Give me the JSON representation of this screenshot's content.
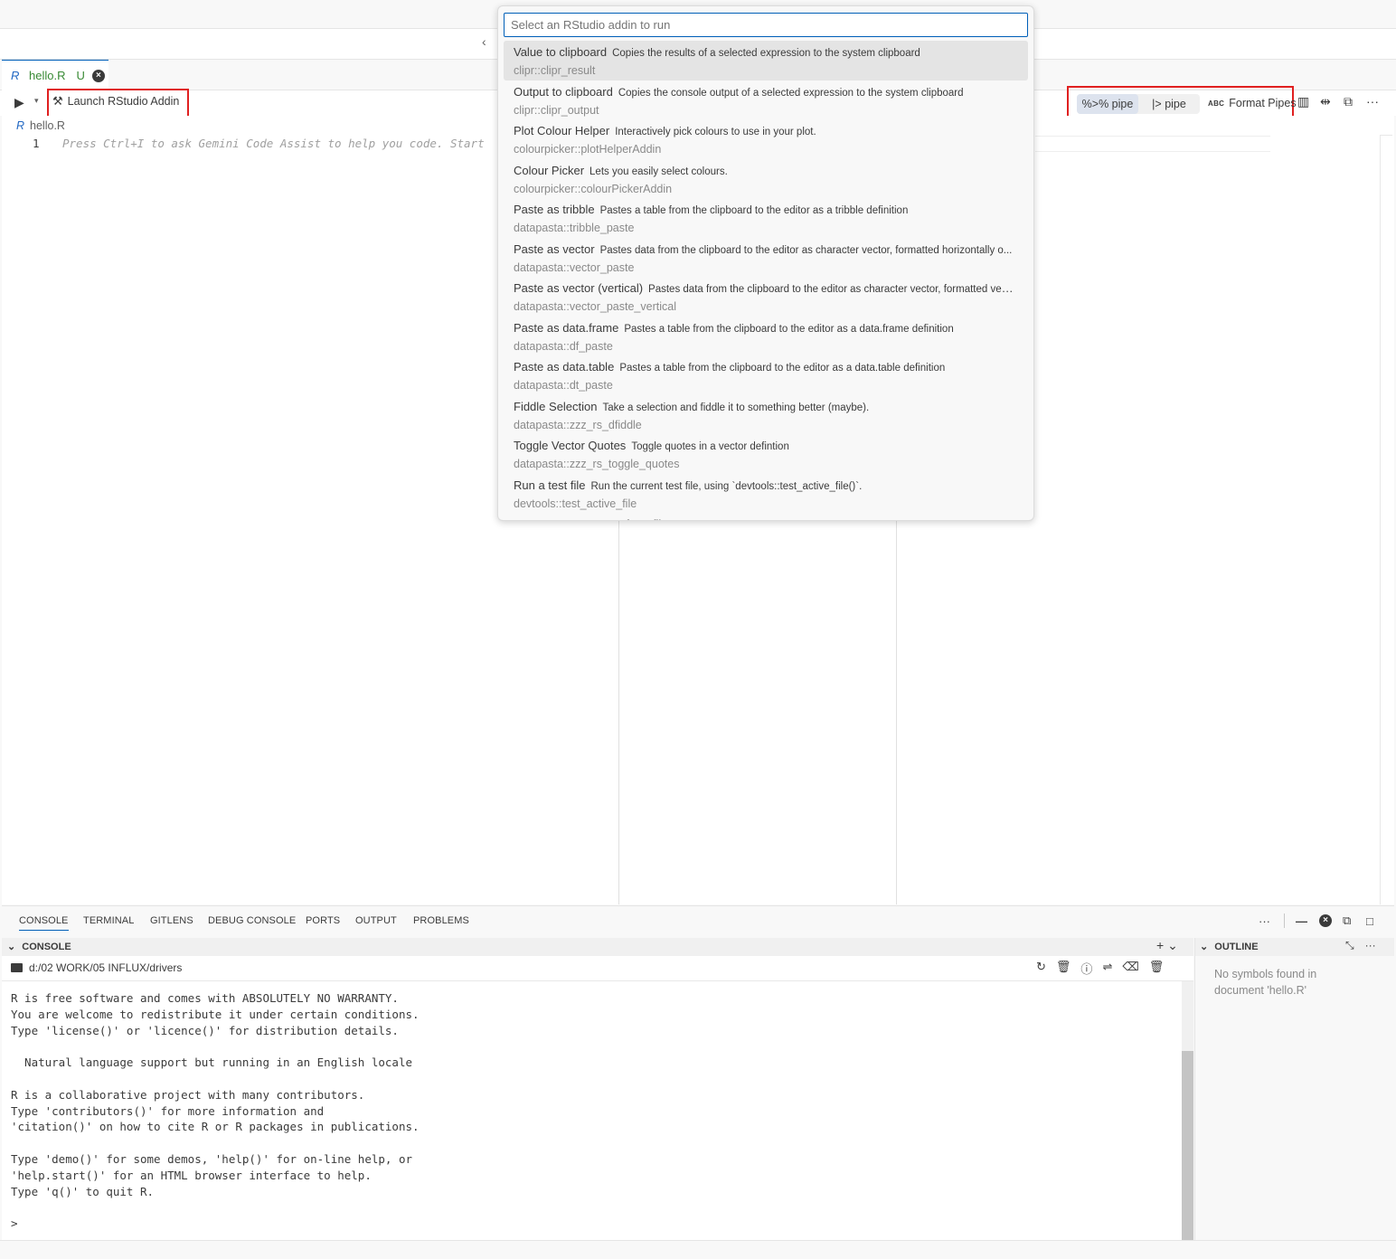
{
  "nav": {
    "back_glyph": "‹"
  },
  "tab": {
    "logo": "R",
    "name": "hello.R",
    "status": "U",
    "close_glyph": "×"
  },
  "toolbar": {
    "run_glyph": "▶",
    "run_dropdown_glyph": "▾",
    "launch_icon": "wrench-icon",
    "launch_glyph": "⚒",
    "launch_label": "Launch RStudio Addin",
    "pipe_magrittr_label": "%>% pipe",
    "pipe_native_label": "|> pipe",
    "format_abc": "ABC",
    "format_label": "Format Pipes",
    "split_glyph": "▥",
    "diff_glyph": "⇹",
    "open_glyph": "⧉",
    "more_glyph": "···"
  },
  "breadcrumb": {
    "logo": "R",
    "file": "hello.R"
  },
  "editor": {
    "line_number": "1",
    "ghost_text": "Press Ctrl+I to ask Gemini Code Assist to help you code. Start"
  },
  "quickpick": {
    "placeholder": "Select an RStudio addin to run",
    "items": [
      {
        "title": "Value to clipboard",
        "desc": "Copies the results of a selected expression to the system clipboard",
        "id": "clipr::clipr_result"
      },
      {
        "title": "Output to clipboard",
        "desc": "Copies the console output of a selected expression to the system clipboard",
        "id": "clipr::clipr_output"
      },
      {
        "title": "Plot Colour Helper",
        "desc": "Interactively pick colours to use in your plot.",
        "id": "colourpicker::plotHelperAddin"
      },
      {
        "title": "Colour Picker",
        "desc": "Lets you easily select colours.",
        "id": "colourpicker::colourPickerAddin"
      },
      {
        "title": "Paste as tribble",
        "desc": "Pastes a table from the clipboard to the editor as a tribble definition",
        "id": "datapasta::tribble_paste"
      },
      {
        "title": "Paste as vector",
        "desc": "Pastes data from the clipboard to the editor as character vector, formatted horizontally o...",
        "id": "datapasta::vector_paste"
      },
      {
        "title": "Paste as vector (vertical)",
        "desc": "Pastes data from the clipboard to the editor as character vector, formatted vert...",
        "id": "datapasta::vector_paste_vertical"
      },
      {
        "title": "Paste as data.frame",
        "desc": "Pastes a table from the clipboard to the editor as a data.frame definition",
        "id": "datapasta::df_paste"
      },
      {
        "title": "Paste as data.table",
        "desc": "Pastes a table from the clipboard to the editor as a data.table definition",
        "id": "datapasta::dt_paste"
      },
      {
        "title": "Fiddle Selection",
        "desc": "Take a selection and fiddle it to something better (maybe).",
        "id": "datapasta::zzz_rs_dfiddle"
      },
      {
        "title": "Toggle Vector Quotes",
        "desc": "Toggle quotes in a vector defintion",
        "id": "datapasta::zzz_rs_toggle_quotes"
      },
      {
        "title": "Run a test file",
        "desc": "Run the current test file, using `devtools::test_active_file()`.",
        "id": "devtools::test_active_file"
      },
      {
        "title": "Report test coverage for a file",
        "desc": "Calculate and report test coverage for the current test file, using `devtoo",
        "id": ""
      }
    ]
  },
  "panel": {
    "tabs": [
      "CONSOLE",
      "TERMINAL",
      "GITLENS",
      "DEBUG CONSOLE",
      "PORTS",
      "OUTPUT",
      "PROBLEMS"
    ],
    "actions": {
      "more": "···",
      "minimize": "—",
      "close": "×",
      "restore": "⧉",
      "maximize": "□"
    }
  },
  "console": {
    "section_chevron": "⌄",
    "section_title": "CONSOLE",
    "add_glyph": "+ ⌄",
    "cwd": "d:/02 WORK/05 INFLUX/drivers",
    "actions": {
      "refresh": "↻",
      "clear": "🗑",
      "info": "ⓘ",
      "wrap": "⇌",
      "clear_alt": "⌫",
      "kill": "🗑"
    },
    "text": "R is free software and comes with ABSOLUTELY NO WARRANTY.\nYou are welcome to redistribute it under certain conditions.\nType 'license()' or 'licence()' for distribution details.\n\n  Natural language support but running in an English locale\n\nR is a collaborative project with many contributors.\nType 'contributors()' for more information and\n'citation()' on how to cite R or R packages in publications.\n\nType 'demo()' for some demos, 'help()' for on-line help, or\n'help.start()' for an HTML browser interface to help.\nType 'q()' to quit R.\n\n>"
  },
  "outline": {
    "chevron": "⌄",
    "title": "OUTLINE",
    "collapse_glyph": "⤡",
    "more_glyph": "···",
    "message": "No symbols found in document 'hello.R'"
  },
  "colors": {
    "accent": "#005fb8",
    "highlight_box": "#e02020",
    "modified": "#388a34"
  }
}
